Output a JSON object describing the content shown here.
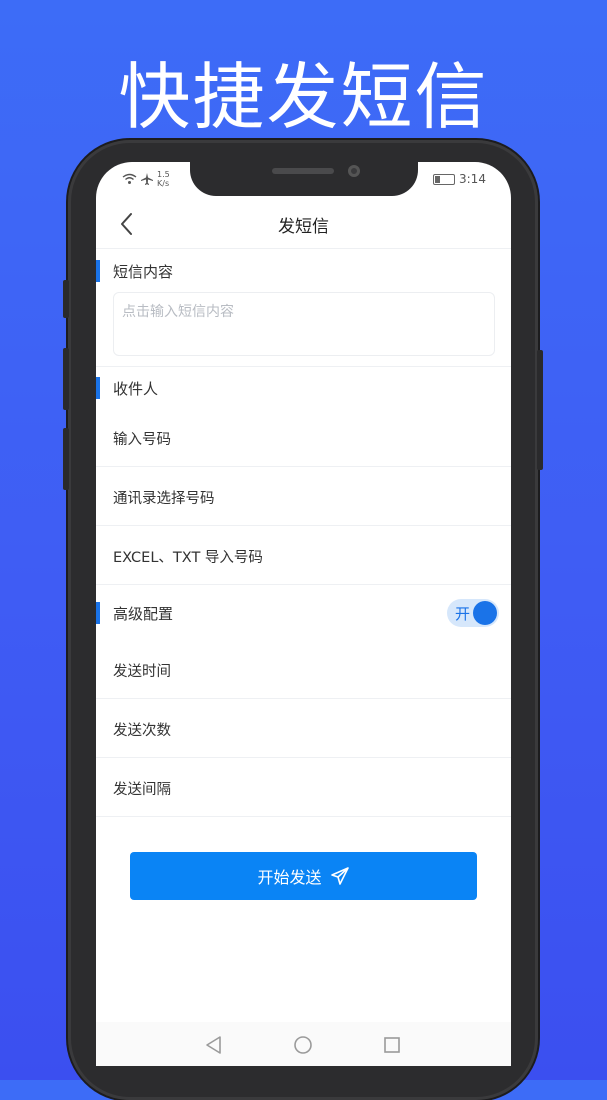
{
  "hero": {
    "title": "快捷发短信"
  },
  "status": {
    "speed_value": "1.5",
    "speed_unit": "K/s",
    "time": "3:14"
  },
  "header": {
    "title": "发短信"
  },
  "sections": {
    "content": {
      "label": "短信内容",
      "placeholder": "点击输入短信内容"
    },
    "recipients": {
      "label": "收件人",
      "items": [
        "输入号码",
        "通讯录选择号码",
        "EXCEL、TXT 导入号码"
      ]
    },
    "advanced": {
      "label": "高级配置",
      "toggle_label": "开",
      "enabled": true,
      "items": [
        "发送时间",
        "发送次数",
        "发送间隔"
      ]
    }
  },
  "actions": {
    "send_label": "开始发送"
  },
  "colors": {
    "accent": "#1a73e8",
    "button": "#0a84f5",
    "background": "#3f5cf4"
  },
  "icons": [
    "wifi-icon",
    "airplane-icon",
    "battery-icon",
    "back-chevron-icon",
    "send-plane-icon",
    "nav-back-triangle-icon",
    "nav-home-circle-icon",
    "nav-recent-square-icon"
  ]
}
